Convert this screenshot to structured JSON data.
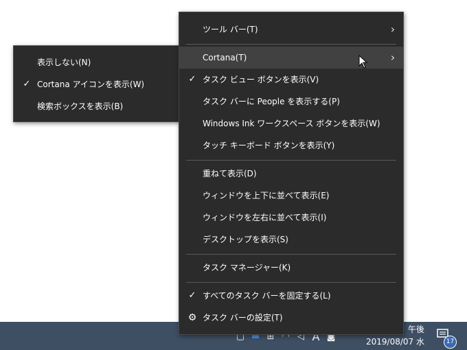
{
  "taskbar": {
    "tray_icons": [
      {
        "icon": "chevron-up-icon",
        "glyph": "⌃"
      },
      {
        "icon": "window-icon",
        "glyph": "▢"
      },
      {
        "icon": "dropbox-icon",
        "glyph": "▬"
      },
      {
        "icon": "network-icon",
        "glyph": "⊞"
      },
      {
        "icon": "wifi-icon",
        "glyph": "◠"
      },
      {
        "icon": "volume-icon",
        "glyph": "◁"
      },
      {
        "icon": "ime-icon",
        "glyph": "A"
      },
      {
        "icon": "app-icon",
        "glyph": "◙"
      }
    ],
    "clock_time": "午後",
    "clock_date": "2019/08/07 水",
    "notification_count": "17",
    "notification_icon": "notification-icon"
  },
  "main_menu": {
    "items": [
      {
        "label": "ツール バー(T)",
        "checked": false,
        "has_submenu": true
      },
      {
        "label": "Cortana(T)",
        "checked": false,
        "has_submenu": true,
        "highlighted": true
      },
      {
        "label": "タスク ビュー ボタンを表示(V)",
        "checked": true
      },
      {
        "label": "タスク バーに People を表示する(P)",
        "checked": false
      },
      {
        "label": "Windows Ink ワークスペース ボタンを表示(W)",
        "checked": false
      },
      {
        "label": "タッチ キーボード ボタンを表示(Y)",
        "checked": false
      },
      {
        "label": "重ねて表示(D)",
        "checked": false
      },
      {
        "label": "ウィンドウを上下に並べて表示(E)",
        "checked": false
      },
      {
        "label": "ウィンドウを左右に並べて表示(I)",
        "checked": false
      },
      {
        "label": "デスクトップを表示(S)",
        "checked": false
      },
      {
        "label": "タスク マネージャー(K)",
        "checked": false
      },
      {
        "label": "すべてのタスク バーを固定する(L)",
        "checked": true
      },
      {
        "label": "タスク バーの設定(T)",
        "checked": false,
        "icon": "gear-icon"
      }
    ],
    "check_glyph": "✓",
    "arrow_glyph": "›",
    "gear_glyph": "⚙"
  },
  "cortana_submenu": {
    "items": [
      {
        "label": "表示しない(N)",
        "checked": false
      },
      {
        "label": "Cortana アイコンを表示(W)",
        "checked": true
      },
      {
        "label": "検索ボックスを表示(B)",
        "checked": false
      }
    ]
  },
  "colors": {
    "menu_bg": "#2b2b2b",
    "highlight": "#414141",
    "taskbar": "#3e4e63",
    "badge": "#3a6ab0"
  }
}
